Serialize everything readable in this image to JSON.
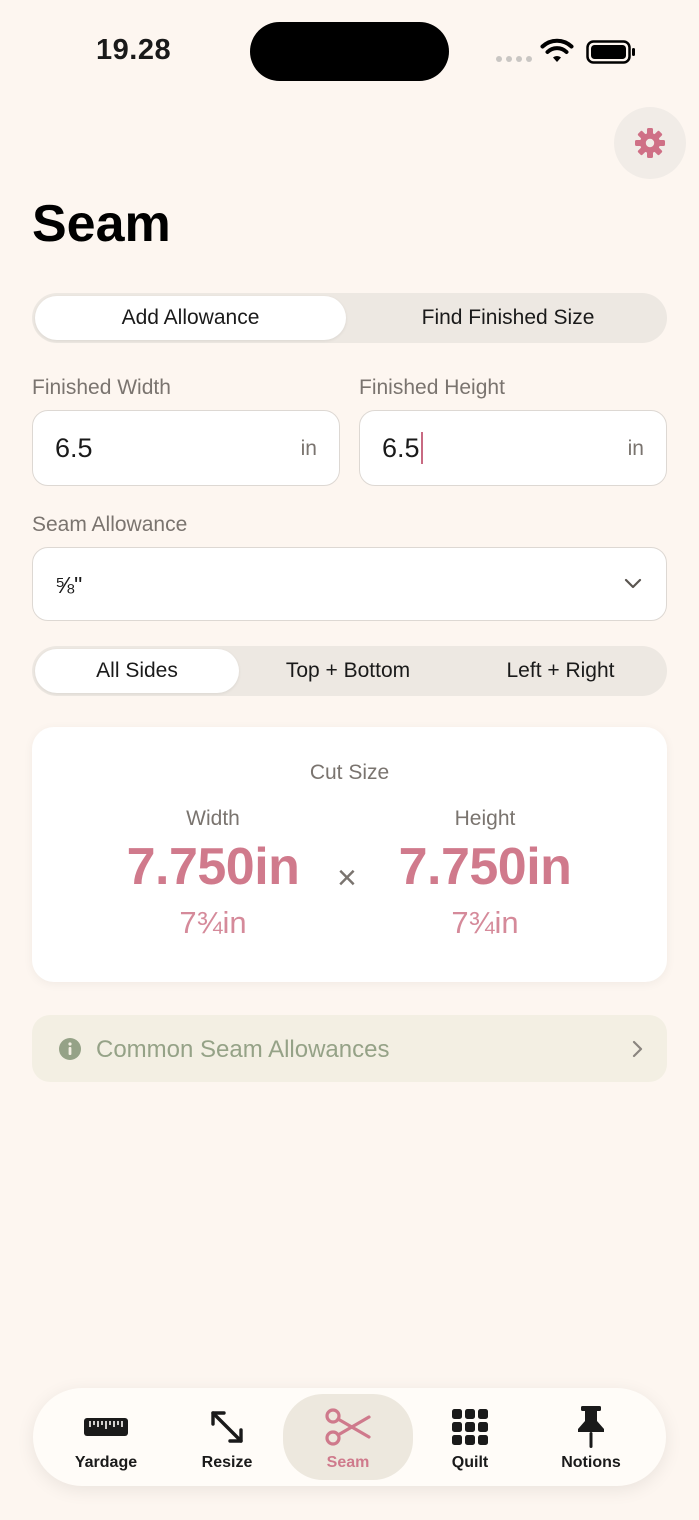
{
  "status_bar": {
    "time": "19.28"
  },
  "header": {
    "title": "Seam",
    "settings_icon": "gear-icon"
  },
  "mode_tabs": [
    {
      "label": "Add Allowance",
      "selected": true
    },
    {
      "label": "Find Finished Size",
      "selected": false
    }
  ],
  "finished_width": {
    "label": "Finished Width",
    "value": "6.5",
    "unit": "in"
  },
  "finished_height": {
    "label": "Finished Height",
    "value": "6.5",
    "unit": "in"
  },
  "seam_allowance": {
    "label": "Seam Allowance",
    "value": "⅝\""
  },
  "sides_tabs": [
    {
      "label": "All Sides",
      "selected": true
    },
    {
      "label": "Top + Bottom",
      "selected": false
    },
    {
      "label": "Left + Right",
      "selected": false
    }
  ],
  "result": {
    "title": "Cut Size",
    "width_label": "Width",
    "width_value": "7.750in",
    "width_fraction": "7¾in",
    "times": "×",
    "height_label": "Height",
    "height_value": "7.750in",
    "height_fraction": "7¾in"
  },
  "info": {
    "label": "Common Seam Allowances"
  },
  "tab_bar": [
    {
      "label": "Yardage",
      "icon": "ruler-icon",
      "selected": false
    },
    {
      "label": "Resize",
      "icon": "resize-arrows-icon",
      "selected": false
    },
    {
      "label": "Seam",
      "icon": "scissors-icon",
      "selected": true
    },
    {
      "label": "Quilt",
      "icon": "grid-icon",
      "selected": false
    },
    {
      "label": "Notions",
      "icon": "pin-icon",
      "selected": false
    }
  ],
  "colors": {
    "accent": "#d07a8c",
    "background": "#fdf6f0",
    "info_text": "#95a287",
    "muted_text": "#7a746f"
  }
}
